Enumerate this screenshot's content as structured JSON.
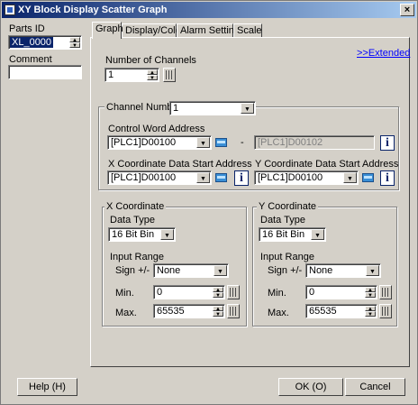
{
  "window": {
    "title": "XY Block Display Scatter Graph",
    "close_glyph": "×"
  },
  "left": {
    "parts_id_label": "Parts ID",
    "parts_id_value": "XL_0000",
    "comment_label": "Comment",
    "comment_value": ""
  },
  "tabs": [
    {
      "label": "Graph"
    },
    {
      "label": "Display/Color"
    },
    {
      "label": "Alarm Settings"
    },
    {
      "label": "Scale"
    }
  ],
  "extended_link": ">>Extended",
  "num_channels": {
    "label": "Number of Channels",
    "value": "1"
  },
  "channel": {
    "group_label": "Channel Number",
    "value": "1",
    "control_word_label": "Control Word Address",
    "control_word_value": "[PLC1]D00100",
    "dash": "-",
    "control_word_end": "[PLC1]D00102",
    "x_start_label": "X Coordinate Data Start Address",
    "x_start_value": "[PLC1]D00100",
    "y_start_label": "Y Coordinate Data Start Address",
    "y_start_value": "[PLC1]D00100",
    "info_glyph": "i"
  },
  "x_coord": {
    "title": "X Coordinate",
    "data_type_label": "Data Type",
    "data_type_value": "16 Bit Bin",
    "input_range_label": "Input Range",
    "sign_label": "Sign +/-",
    "sign_value": "None",
    "min_label": "Min.",
    "min_value": "0",
    "max_label": "Max.",
    "max_value": "65535"
  },
  "y_coord": {
    "title": "Y Coordinate",
    "data_type_label": "Data Type",
    "data_type_value": "16 Bit Bin",
    "input_range_label": "Input Range",
    "sign_label": "Sign +/-",
    "sign_value": "None",
    "min_label": "Min.",
    "min_value": "0",
    "max_label": "Max.",
    "max_value": "65535"
  },
  "buttons": {
    "help": "Help (H)",
    "ok": "OK (O)",
    "cancel": "Cancel"
  }
}
